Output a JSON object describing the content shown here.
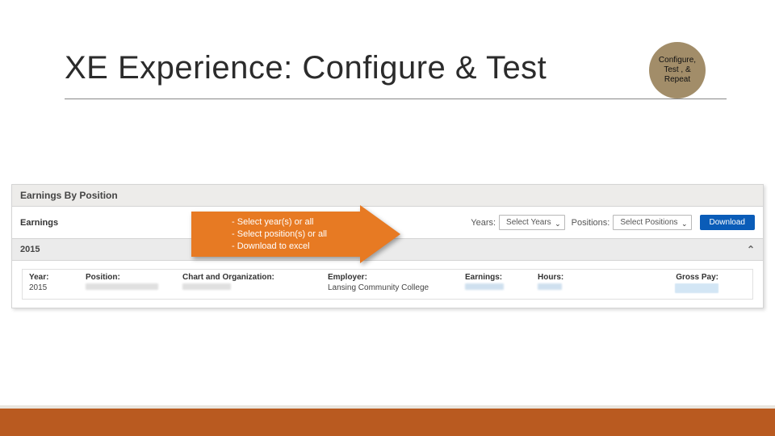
{
  "title": "XE Experience: Configure & Test",
  "badge": {
    "line1": "Configure,",
    "line2": "Test , &",
    "line3": "Repeat"
  },
  "panel": {
    "header": "Earnings By Position",
    "earnings_label": "Earnings",
    "years_label": "Years:",
    "years_select": "Select Years",
    "positions_label": "Positions:",
    "positions_select": "Select Positions",
    "download": "Download",
    "year_group": "2015",
    "columns": {
      "year": "Year:",
      "position": "Position:",
      "chart": "Chart and Organization:",
      "employer": "Employer:",
      "earnings": "Earnings:",
      "hours": "Hours:",
      "gross": "Gross Pay:"
    },
    "row": {
      "year": "2015",
      "employer": "Lansing Community College"
    }
  },
  "callout": {
    "l1": "Select year(s) or all",
    "l2": "Select position(s) or all",
    "l3": "Download to excel"
  }
}
